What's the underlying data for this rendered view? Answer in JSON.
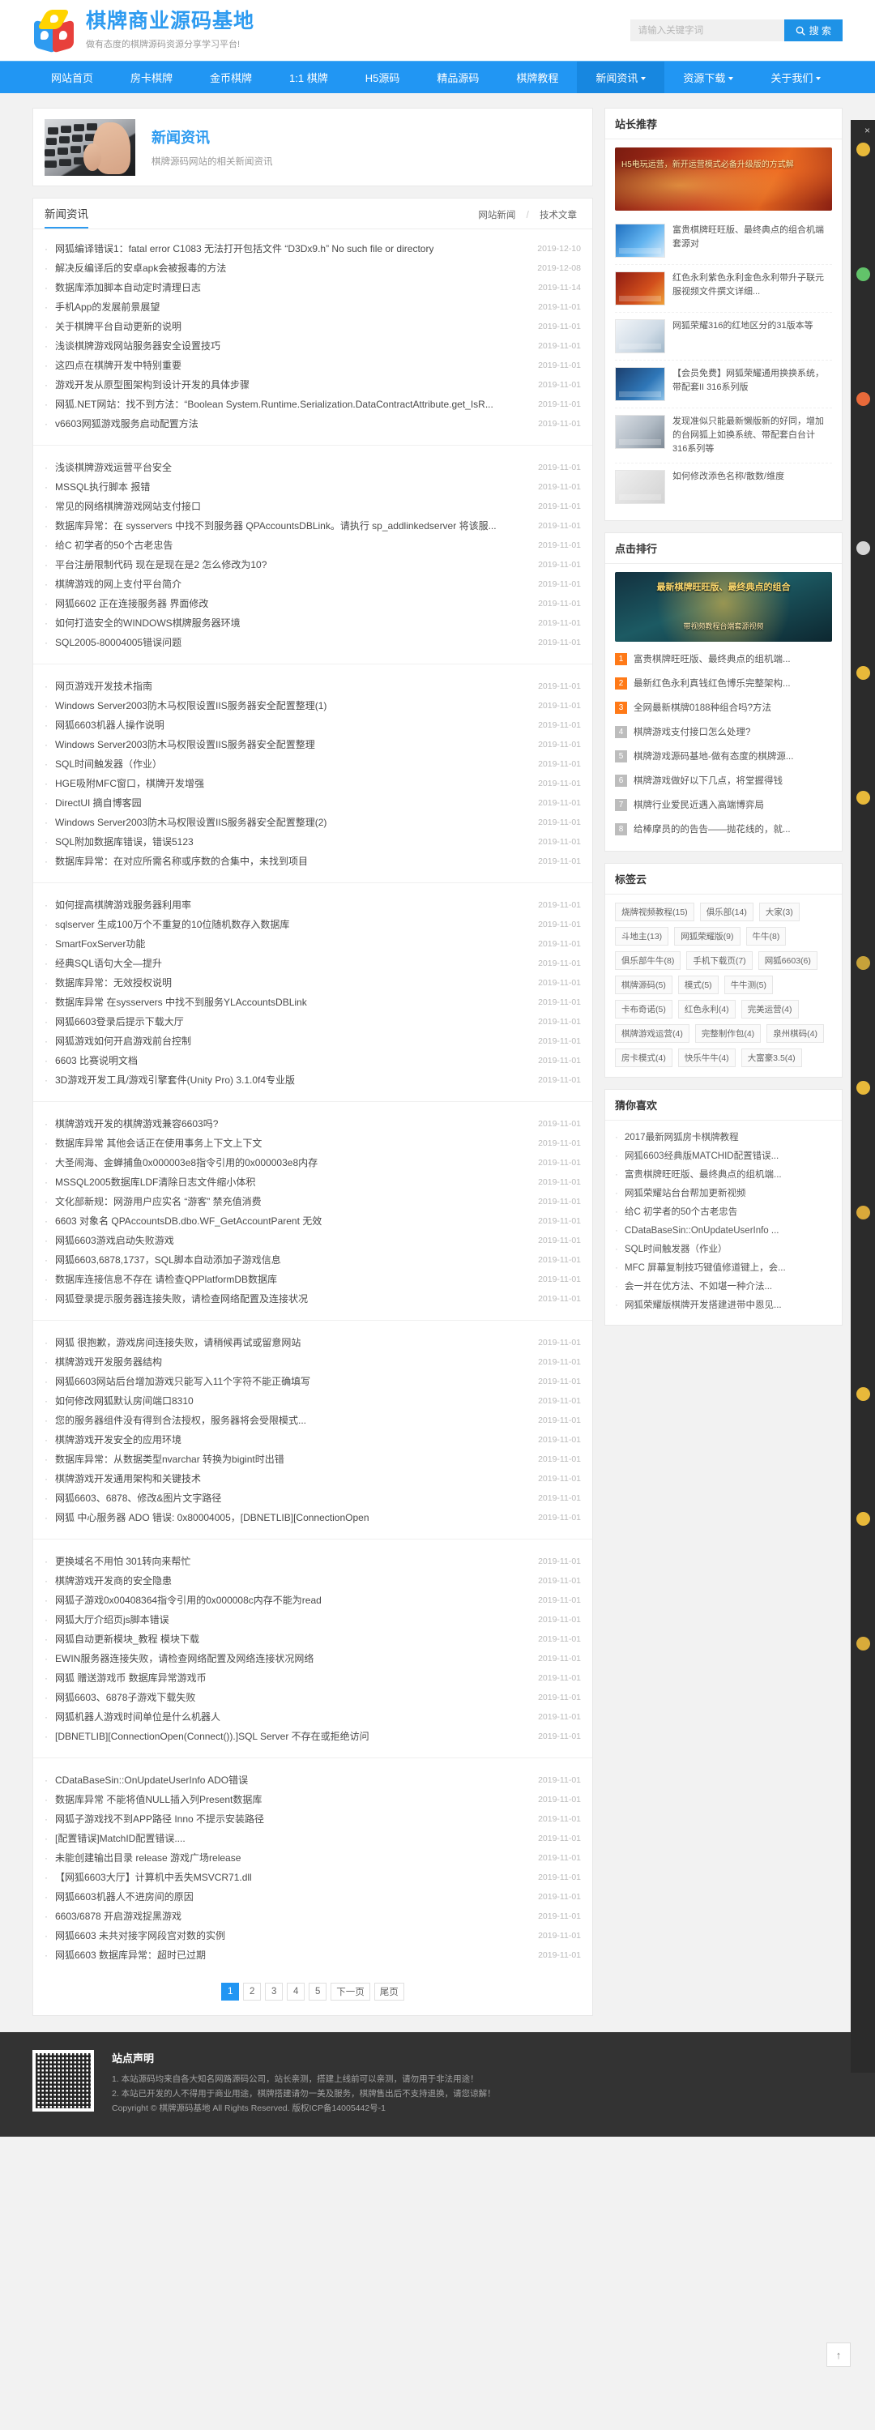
{
  "header": {
    "site_title": "棋牌商业源码基地",
    "site_sub": "做有态度的棋牌源码资源分享学习平台!",
    "search_placeholder": "请输入关键字词",
    "search_button": "搜 索",
    "logo_icon": "cube-logo-icon",
    "search_icon": "search-icon"
  },
  "nav": {
    "items": [
      {
        "label": "网站首页",
        "dropdown": false,
        "active": false
      },
      {
        "label": "房卡棋牌",
        "dropdown": false,
        "active": false
      },
      {
        "label": "金币棋牌",
        "dropdown": false,
        "active": false
      },
      {
        "label": "1:1 棋牌",
        "dropdown": false,
        "active": false
      },
      {
        "label": "H5源码",
        "dropdown": false,
        "active": false
      },
      {
        "label": "精品源码",
        "dropdown": false,
        "active": false
      },
      {
        "label": "棋牌教程",
        "dropdown": false,
        "active": false
      },
      {
        "label": "新闻资讯",
        "dropdown": true,
        "active": true
      },
      {
        "label": "资源下载",
        "dropdown": true,
        "active": false
      },
      {
        "label": "关于我们",
        "dropdown": true,
        "active": false
      }
    ]
  },
  "banner": {
    "title": "新闻资讯",
    "desc": "棋牌源码网站的相关新闻资讯",
    "image_name": "keyboard-typing-photo"
  },
  "list": {
    "head_title": "新闻资讯",
    "tab_left": "网站新闻",
    "tab_sep": "/",
    "tab_right": "技术文章",
    "groups": [
      [
        {
          "title": "网狐编译错误1：fatal error C1083 无法打开包括文件 “D3Dx9.h” No such file or directory",
          "date": "2019-12-10"
        },
        {
          "title": "解决反编译后的安卓apk会被报毒的方法",
          "date": "2019-12-08"
        },
        {
          "title": "数据库添加脚本自动定时清理日志",
          "date": "2019-11-14"
        },
        {
          "title": "手机App的发展前景展望",
          "date": "2019-11-01"
        },
        {
          "title": "关于棋牌平台自动更新的说明",
          "date": "2019-11-01"
        },
        {
          "title": "浅谈棋牌游戏网站服务器安全设置技巧",
          "date": "2019-11-01"
        },
        {
          "title": "这四点在棋牌开发中特别重要",
          "date": "2019-11-01"
        },
        {
          "title": "游戏开发从原型图架构到设计开发的具体步骤",
          "date": "2019-11-01"
        },
        {
          "title": "网狐.NET网站：找不到方法：“Boolean System.Runtime.Serialization.DataContractAttribute.get_IsR...",
          "date": "2019-11-01"
        },
        {
          "title": "v6603网狐游戏服务启动配置方法",
          "date": "2019-11-01"
        }
      ],
      [
        {
          "title": "浅谈棋牌游戏运营平台安全",
          "date": "2019-11-01"
        },
        {
          "title": "MSSQL执行脚本 报错",
          "date": "2019-11-01"
        },
        {
          "title": "常见的网络棋牌游戏网站支付接口",
          "date": "2019-11-01"
        },
        {
          "title": "数据库异常：在 sysservers 中找不到服务器 QPAccountsDBLink。请执行 sp_addlinkedserver 将该服...",
          "date": "2019-11-01"
        },
        {
          "title": "给C 初学者的50个古老忠告",
          "date": "2019-11-01"
        },
        {
          "title": "平台注册限制代码 现在是现在是2 怎么修改为10?",
          "date": "2019-11-01"
        },
        {
          "title": "棋牌游戏的网上支付平台简介",
          "date": "2019-11-01"
        },
        {
          "title": "网狐6602 正在连接服务器 界面修改",
          "date": "2019-11-01"
        },
        {
          "title": "如何打造安全的WINDOWS棋牌服务器环境",
          "date": "2019-11-01"
        },
        {
          "title": "SQL2005-80004005错误问题",
          "date": "2019-11-01"
        }
      ],
      [
        {
          "title": "网页游戏开发技术指南",
          "date": "2019-11-01"
        },
        {
          "title": "Windows Server2003防木马权限设置IIS服务器安全配置整理(1)",
          "date": "2019-11-01"
        },
        {
          "title": "网狐6603机器人操作说明",
          "date": "2019-11-01"
        },
        {
          "title": "Windows Server2003防木马权限设置IIS服务器安全配置整理",
          "date": "2019-11-01"
        },
        {
          "title": "SQL时间触发器（作业）",
          "date": "2019-11-01"
        },
        {
          "title": "HGE吸附MFC窗口，棋牌开发增强",
          "date": "2019-11-01"
        },
        {
          "title": "DirectUI 摘自博客园",
          "date": "2019-11-01"
        },
        {
          "title": "Windows Server2003防木马权限设置IIS服务器安全配置整理(2)",
          "date": "2019-11-01"
        },
        {
          "title": "SQL附加数据库错误，错误5123",
          "date": "2019-11-01"
        },
        {
          "title": "数据库异常：在对应所需名称或序数的合集中，未找到项目",
          "date": "2019-11-01"
        }
      ],
      [
        {
          "title": "如何提高棋牌游戏服务器利用率",
          "date": "2019-11-01"
        },
        {
          "title": "sqlserver 生成100万个不重复的10位随机数存入数据库",
          "date": "2019-11-01"
        },
        {
          "title": "SmartFoxServer功能",
          "date": "2019-11-01"
        },
        {
          "title": "经典SQL语句大全—提升",
          "date": "2019-11-01"
        },
        {
          "title": "数据库异常：无效授权说明",
          "date": "2019-11-01"
        },
        {
          "title": "数据库异常 在sysservers 中找不到服务YLAccountsDBLink",
          "date": "2019-11-01"
        },
        {
          "title": "网狐6603登录后提示下载大厅",
          "date": "2019-11-01"
        },
        {
          "title": "网狐游戏如何开启游戏前台控制",
          "date": "2019-11-01"
        },
        {
          "title": "6603 比赛说明文档",
          "date": "2019-11-01"
        },
        {
          "title": "3D游戏开发工具/游戏引擎套件(Unity Pro) 3.1.0f4专业版",
          "date": "2019-11-01"
        }
      ],
      [
        {
          "title": "棋牌游戏开发的棋牌游戏兼容6603吗?",
          "date": "2019-11-01"
        },
        {
          "title": "数据库异常 其他会话正在使用事务上下文上下文",
          "date": "2019-11-01"
        },
        {
          "title": "大圣闹海、金蝉捕鱼0x000003e8指令引用的0x000003e8内存",
          "date": "2019-11-01"
        },
        {
          "title": "MSSQL2005数据库LDF清除日志文件缩小体积",
          "date": "2019-11-01"
        },
        {
          "title": "文化部新规：网游用户应实名 “游客” 禁充值消费",
          "date": "2019-11-01"
        },
        {
          "title": "6603 对象名 QPAccountsDB.dbo.WF_GetAccountParent 无效",
          "date": "2019-11-01"
        },
        {
          "title": "网狐6603游戏启动失败游戏",
          "date": "2019-11-01"
        },
        {
          "title": "网狐6603,6878,1737，SQL脚本自动添加子游戏信息",
          "date": "2019-11-01"
        },
        {
          "title": "数据库连接信息不存在 请检查QPPlatformDB数据库",
          "date": "2019-11-01"
        },
        {
          "title": "网狐登录提示服务器连接失败，请检查网络配置及连接状况",
          "date": "2019-11-01"
        }
      ],
      [
        {
          "title": "网狐 很抱歉，游戏房间连接失败，请稍候再试或留意网站",
          "date": "2019-11-01"
        },
        {
          "title": "棋牌游戏开发服务器结构",
          "date": "2019-11-01"
        },
        {
          "title": "网狐6603网站后台增加游戏只能写入11个字符不能正确填写",
          "date": "2019-11-01"
        },
        {
          "title": "如何修改网狐默认房间端口8310",
          "date": "2019-11-01"
        },
        {
          "title": "您的服务器组件没有得到合法授权，服务器将会受限模式...",
          "date": "2019-11-01"
        },
        {
          "title": "棋牌游戏开发安全的应用环境",
          "date": "2019-11-01"
        },
        {
          "title": "数据库异常：从数据类型nvarchar 转换为bigint时出错",
          "date": "2019-11-01"
        },
        {
          "title": "棋牌游戏开发通用架构和关键技术",
          "date": "2019-11-01"
        },
        {
          "title": "网狐6603、6878、修改&图片文字路径",
          "date": "2019-11-01"
        },
        {
          "title": "网狐 中心服务器 ADO 错误: 0x80004005，[DBNETLIB][ConnectionOpen",
          "date": "2019-11-01"
        }
      ],
      [
        {
          "title": "更换域名不用怕 301转向来帮忙",
          "date": "2019-11-01"
        },
        {
          "title": "棋牌游戏开发商的安全隐患",
          "date": "2019-11-01"
        },
        {
          "title": "网狐子游戏0x00408364指令引用的0x000008c内存不能为read",
          "date": "2019-11-01"
        },
        {
          "title": "网狐大厅介绍页js脚本错误",
          "date": "2019-11-01"
        },
        {
          "title": "网狐自动更新模块_教程 模块下载",
          "date": "2019-11-01"
        },
        {
          "title": "EWIN服务器连接失败，请检查网络配置及网络连接状况网络",
          "date": "2019-11-01"
        },
        {
          "title": "网狐 赠送游戏币 数据库异常游戏币",
          "date": "2019-11-01"
        },
        {
          "title": "网狐6603、6878子游戏下载失败",
          "date": "2019-11-01"
        },
        {
          "title": "网狐机器人游戏时间单位是什么机器人",
          "date": "2019-11-01"
        },
        {
          "title": "[DBNETLIB][ConnectionOpen(Connect()).]SQL Server 不存在或拒绝访问",
          "date": "2019-11-01"
        }
      ],
      [
        {
          "title": "CDataBaseSin::OnUpdateUserInfo ADO错误",
          "date": "2019-11-01"
        },
        {
          "title": "数据库异常 不能将值NULL插入列Present数据库",
          "date": "2019-11-01"
        },
        {
          "title": "网狐子游戏找不到APP路径 Inno 不提示安装路径",
          "date": "2019-11-01"
        },
        {
          "title": "[配置错误]MatchID配置错误....",
          "date": "2019-11-01"
        },
        {
          "title": "未能创建输出目录 release 游戏广场release",
          "date": "2019-11-01"
        },
        {
          "title": "【网狐6603大厅】计算机中丢失MSVCR71.dll",
          "date": "2019-11-01"
        },
        {
          "title": "网狐6603机器人不进房间的原因",
          "date": "2019-11-01"
        },
        {
          "title": "6603/6878 开启游戏捉黑游戏",
          "date": "2019-11-01"
        },
        {
          "title": "网狐6603 未共对接字网段宫对数的实例",
          "date": "2019-11-01"
        },
        {
          "title": "网狐6603 数据库异常：超时已过期",
          "date": "2019-11-01"
        }
      ]
    ],
    "pagination": {
      "pages": [
        "1",
        "2",
        "3",
        "4",
        "5"
      ],
      "active": "1",
      "next_label": "下一页",
      "last_label": "尾页"
    }
  },
  "sidebar": {
    "recommend": {
      "title": "站长推荐",
      "promo_text": "H5电玩运营，新开运营模式必备升级版的方式解",
      "items": [
        {
          "title": "富贵棋牌旺旺版、最终典点的组合机端套源对",
          "thumb": "t2"
        },
        {
          "title": "红色永利紫色永利金色永利带升子联元服视频文件撰文详细...",
          "thumb": "t1"
        },
        {
          "title": "网狐荣耀316的红地区分的31版本等",
          "thumb": "t3"
        },
        {
          "title": "【会员免费】网狐荣耀通用换换系统，带配套II 316系列版",
          "thumb": "t4"
        },
        {
          "title": "发现准似只能最新懒版新的好同，增加的台网狐上如换系统、带配套白台计 316系列等",
          "thumb": "t5"
        },
        {
          "title": "如何修改添色名称/散数/维度",
          "thumb": "t6"
        }
      ]
    },
    "rank": {
      "title": "点击排行",
      "banner_title": "最新棋牌旺旺版、最终典点的组合",
      "banner_sub": "带视频教程台端套源视频",
      "items": [
        {
          "n": "1",
          "title": "富贵棋牌旺旺版、最终典点的组机端...",
          "hot": true
        },
        {
          "n": "2",
          "title": "最新红色永利真钱红色博乐完整架构...",
          "hot": true
        },
        {
          "n": "3",
          "title": "全网最新棋牌0188种组合吗?方法",
          "hot": true
        },
        {
          "n": "4",
          "title": "棋牌游戏支付接口怎么处理?",
          "hot": false
        },
        {
          "n": "5",
          "title": "棋牌游戏源码基地-做有态度的棋牌源...",
          "hot": false
        },
        {
          "n": "6",
          "title": "棋牌游戏做好以下几点，将堂握得钱",
          "hot": false
        },
        {
          "n": "7",
          "title": "棋牌行业爱民近遇入高端博弈局",
          "hot": false
        },
        {
          "n": "8",
          "title": "给棒摩员的的告告——抛花线的，就...",
          "hot": false
        }
      ]
    },
    "tags": {
      "title": "标签云",
      "items": [
        "烧牌视频教程(15)",
        "俱乐部(14)",
        "大家(3)",
        "斗地主(13)",
        "网狐荣耀版(9)",
        "牛牛(8)",
        "俱乐部牛牛(8)",
        "手机下载页(7)",
        "网狐6603(6)",
        "棋牌源码(5)",
        "模式(5)",
        "牛牛测(5)",
        "卡布奇诺(5)",
        "红色永利(4)",
        "完美运营(4)",
        "棋牌游戏运营(4)",
        "完整制作包(4)",
        "泉州棋码(4)",
        "房卡模式(4)",
        "快乐牛牛(4)",
        "大富豪3.5(4)"
      ]
    },
    "like": {
      "title": "猜你喜欢",
      "items": [
        "2017最新网狐房卡棋牌教程",
        "网狐6603经典版MATCHID配置错误...",
        "富贵棋牌旺旺版、最终典点的组机端...",
        "网狐荣耀站台台帮加更新视频",
        "给C 初学者的50个古老忠告",
        "CDataBaseSin::OnUpdateUserInfo ...",
        "SQL时间触发器（作业）",
        "MFC 屏幕复制技巧键值修道键上，会...",
        "会一并在优方法、不如堪一种介法...",
        "网狐荣耀版棋牌开发搭建进带中恩见..."
      ]
    }
  },
  "ad_rail": {
    "close_label": "×",
    "close_icon": "close-icon",
    "icons": [
      "qq-icon",
      "wechat-icon",
      "phone-icon",
      "mail-icon",
      "qr-icon",
      "service-icon",
      "chat-icon",
      "star-icon",
      "top-icon",
      "more-icon",
      "help-icon",
      "info-icon"
    ]
  },
  "footer": {
    "title": "站点声明",
    "qr_name": "wechat-qr-code",
    "lines": [
      "1. 本站源码均来自各大知名网路源码公司，站长亲测，搭建上线前可以亲测，请勿用于非法用途！",
      "2. 本站已开发的人不得用于商业用途，棋牌搭建请勿一美及服务，棋牌售出后不支持退换，请您谅解！",
      "Copyright © 棋牌源码基地 All Rights Reserved. 版权ICP备14005442号-1"
    ]
  },
  "backtop": {
    "label": "↑",
    "icon": "arrow-up-icon"
  }
}
